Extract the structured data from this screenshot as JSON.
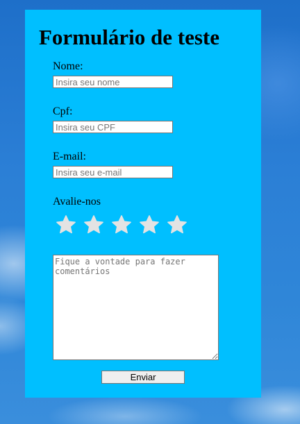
{
  "form": {
    "title": "Formulário de teste",
    "fields": {
      "name": {
        "label": "Nome:",
        "placeholder": "Insira seu nome",
        "value": ""
      },
      "cpf": {
        "label": "Cpf:",
        "placeholder": "Insira seu CPF",
        "value": ""
      },
      "email": {
        "label": "E-mail:",
        "placeholder": "Insira seu e-mail",
        "value": ""
      }
    },
    "rating": {
      "label": "Avalie-nos",
      "max": 5,
      "selected": 0
    },
    "comments": {
      "placeholder": "Fique a vontade para fazer comentários",
      "value": ""
    },
    "submit_label": "Enviar"
  },
  "colors": {
    "panel_background": "#00bfff",
    "star_unselected": "#e3e3e3",
    "page_background": "#2b7fd6"
  },
  "icons": {
    "rating_star": "star-icon"
  }
}
